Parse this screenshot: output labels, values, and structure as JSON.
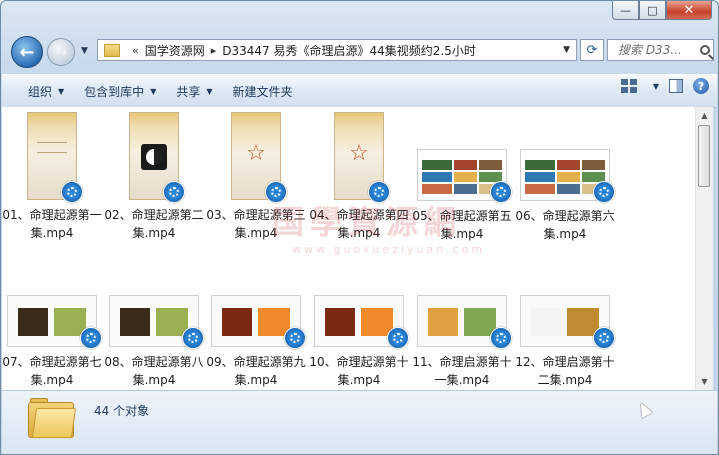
{
  "window": {
    "minimize_glyph": "—",
    "maximize_glyph": "□",
    "close_glyph": "✕"
  },
  "nav": {
    "back_glyph": "←",
    "forward_glyph": "→",
    "breadcrumb_prefix": "«",
    "breadcrumb": [
      "国学资源网",
      "D33447 易秀《命理启源》44集视频约2.5小时"
    ],
    "breadcrumb_sep": "▸",
    "refresh_glyph": "⟳",
    "search_placeholder": "搜索 D33..."
  },
  "toolbar": {
    "organize": "组织",
    "include_in_library": "包含到库中",
    "share": "共享",
    "new_folder": "新建文件夹",
    "help": "?"
  },
  "files": [
    {
      "name": "01、命理起源第一集.mp4",
      "thumb": "portrait",
      "variant": "title"
    },
    {
      "name": "02、命理起源第二集.mp4",
      "thumb": "portrait",
      "variant": "yinyang"
    },
    {
      "name": "03、命理起源第三集.mp4",
      "thumb": "portrait",
      "variant": "star"
    },
    {
      "name": "04、命理起源第四集.mp4",
      "thumb": "portrait",
      "variant": "star"
    },
    {
      "name": "05、命理起源第五集.mp4",
      "thumb": "land",
      "variant": "photos"
    },
    {
      "name": "06、命理起源第六集.mp4",
      "thumb": "land",
      "variant": "photos"
    },
    {
      "name": "07、命理起源第七集.mp4",
      "thumb": "slide",
      "variant": "tree"
    },
    {
      "name": "08、命理起源第八集.mp4",
      "thumb": "slide",
      "variant": "tree"
    },
    {
      "name": "09、命理起源第九集.mp4",
      "thumb": "slide",
      "variant": "sunset"
    },
    {
      "name": "10、命理起源第十集.mp4",
      "thumb": "slide",
      "variant": "sunset"
    },
    {
      "name": "11、命理启源第十一集.mp4",
      "thumb": "slide",
      "variant": "field"
    },
    {
      "name": "12、命理启源第十二集.mp4",
      "thumb": "slide",
      "variant": "weapon"
    }
  ],
  "watermark": {
    "text": "国學資源網",
    "url": "www.guoxueziyuan.com"
  },
  "status": {
    "count_text": "44 个对象"
  },
  "colors": {
    "accent": "#1e395b",
    "media_badge": "#2b86d8"
  }
}
